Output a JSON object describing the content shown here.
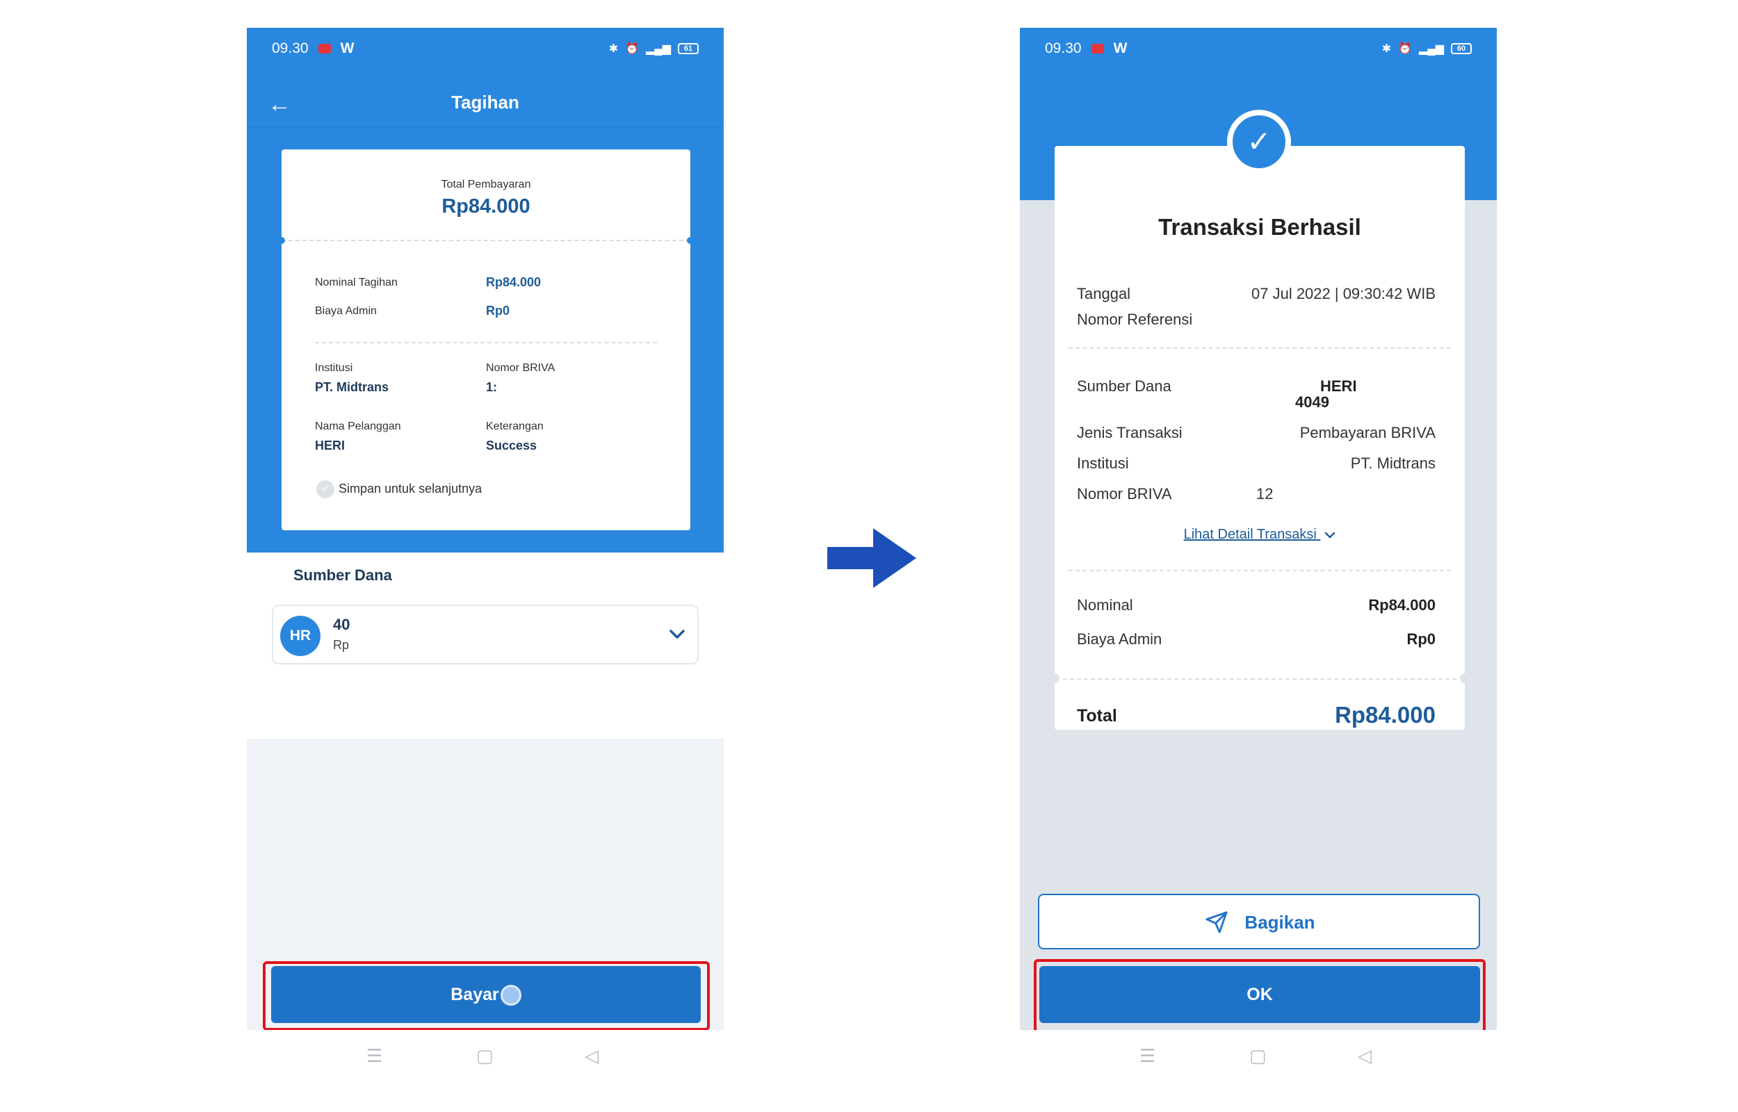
{
  "left": {
    "status": {
      "time": "09.30",
      "w": "W",
      "battery": "61"
    },
    "appbar": {
      "back": "←",
      "title": "Tagihan"
    },
    "ticket": {
      "total_label": "Total Pembayaran",
      "total_value": "Rp84.000",
      "nominal_label": "Nominal Tagihan",
      "nominal_value": "Rp84.000",
      "admin_label": "Biaya Admin",
      "admin_value": "Rp0",
      "institusi_label": "Institusi",
      "institusi_value": "PT. Midtrans",
      "briva_label": "Nomor BRIVA",
      "briva_value": "1:",
      "pelanggan_label": "Nama Pelanggan",
      "pelanggan_value": "HERI",
      "keterangan_label": "Keterangan",
      "keterangan_value": "Success",
      "save_label": "Simpan untuk selanjutnya"
    },
    "sumber_dana": {
      "title": "Sumber Dana",
      "avatar": "HR",
      "account": "40",
      "balance": "Rp"
    },
    "pay_button": "Bayar"
  },
  "right": {
    "status": {
      "time": "09.30",
      "w": "W",
      "battery": "60"
    },
    "receipt": {
      "title": "Transaksi Berhasil",
      "tanggal_label": "Tanggal",
      "tanggal_value": "07 Jul 2022 | 09:30:42 WIB",
      "referensi_label": "Nomor Referensi",
      "sumber_label": "Sumber Dana",
      "sumber_name": "HERI",
      "sumber_num": "4049",
      "jenis_label": "Jenis Transaksi",
      "jenis_value": "Pembayaran BRIVA",
      "institusi_label": "Institusi",
      "institusi_value": "PT. Midtrans",
      "briva_label": "Nomor BRIVA",
      "briva_value": "12",
      "detail_link": "Lihat Detail Transaksi",
      "nominal_label": "Nominal",
      "nominal_value": "Rp84.000",
      "admin_label": "Biaya Admin",
      "admin_value": "Rp0",
      "total_label": "Total",
      "total_value": "Rp84.000"
    },
    "share_button": "Bagikan",
    "ok_button": "OK"
  },
  "colors": {
    "primary": "#2a87df",
    "button": "#1f73c7",
    "highlight": "#e0141b",
    "arrow": "#1c4fb8"
  },
  "icons": [
    "back-arrow-icon",
    "check-icon",
    "chevron-down-icon",
    "send-icon",
    "menu-icon",
    "home-square-icon",
    "back-triangle-icon"
  ]
}
